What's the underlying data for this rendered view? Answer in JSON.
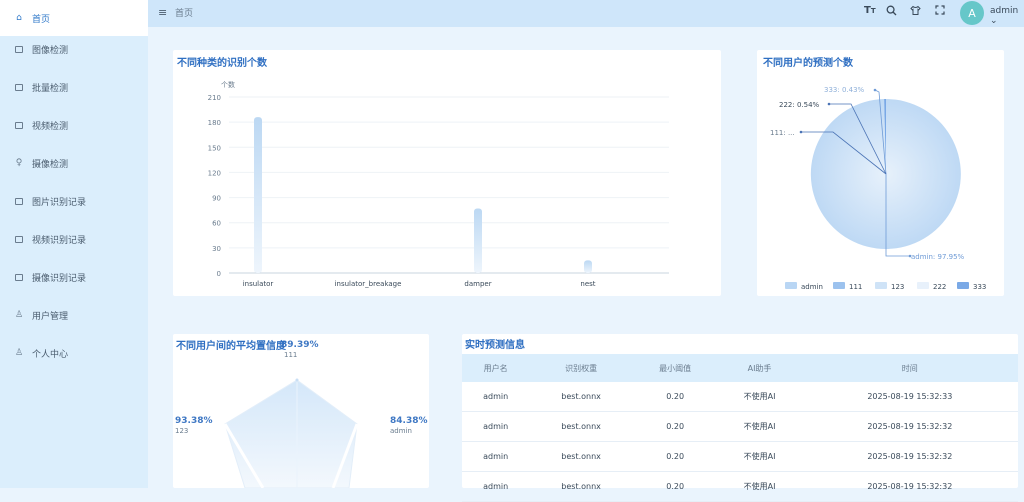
{
  "sidebar": {
    "items": [
      {
        "label": "首页",
        "icon": "home-icon"
      },
      {
        "label": "图像检测",
        "icon": "image-icon"
      },
      {
        "label": "批量检测",
        "icon": "batch-icon"
      },
      {
        "label": "视频检测",
        "icon": "video-icon"
      },
      {
        "label": "摄像检测",
        "icon": "camera-icon"
      },
      {
        "label": "图片识别记录",
        "icon": "image-record-icon"
      },
      {
        "label": "视频识别记录",
        "icon": "video-record-icon"
      },
      {
        "label": "摄像识别记录",
        "icon": "camera-record-icon"
      },
      {
        "label": "用户管理",
        "icon": "user-manage-icon"
      },
      {
        "label": "个人中心",
        "icon": "profile-icon"
      }
    ]
  },
  "header": {
    "menu_icon": "menu-icon",
    "breadcrumb": "首页",
    "font_size_icon_label": "T",
    "user": "admin",
    "avatar_char": "A"
  },
  "bar_chart": {
    "title": "不同种类的识别个数",
    "y_unit": "个数",
    "y_ticks": [
      "0",
      "30",
      "60",
      "90",
      "120",
      "150",
      "180",
      "210"
    ],
    "ylim": [
      0,
      210
    ],
    "categories": [
      "insulator",
      "insulator_breakage",
      "damper",
      "nest"
    ],
    "values": [
      186,
      0,
      77,
      15
    ],
    "color": "#bcd8f3"
  },
  "pie_chart": {
    "title": "不同用户的预测个数",
    "slices": [
      {
        "name": "admin",
        "percent": 97.95,
        "label": "admin: 97.95%",
        "color": "#b9d6f4"
      },
      {
        "name": "111",
        "percent": 0.54,
        "label": "111: ...",
        "color": "#9cc2ee"
      },
      {
        "name": "123",
        "percent": 0.54,
        "label": "",
        "color": "#cfe3f7"
      },
      {
        "name": "222",
        "percent": 0.54,
        "label": "222: 0.54%",
        "color": "#e8f1fb"
      },
      {
        "name": "333",
        "percent": 0.43,
        "label": "333: 0.43%",
        "color": "#7aa9e6"
      }
    ],
    "legend": [
      "admin",
      "111",
      "123",
      "222",
      "333"
    ]
  },
  "radar_chart": {
    "title": "不同用户间的平均置信度",
    "points": [
      {
        "user": "111",
        "value": "89.39%"
      },
      {
        "user": "admin",
        "value": "84.38%"
      },
      {
        "user": "123",
        "value": "93.38%"
      }
    ]
  },
  "table": {
    "title": "实时预测信息",
    "headers": [
      "用户名",
      "识别权重",
      "最小阈值",
      "AI助手",
      "时间"
    ],
    "rows": [
      [
        "admin",
        "best.onnx",
        "0.20",
        "不使用AI",
        "2025-08-19 15:32:33"
      ],
      [
        "admin",
        "best.onnx",
        "0.20",
        "不使用AI",
        "2025-08-19 15:32:32"
      ],
      [
        "admin",
        "best.onnx",
        "0.20",
        "不使用AI",
        "2025-08-19 15:32:32"
      ],
      [
        "admin",
        "best.onnx",
        "0.20",
        "不使用AI",
        "2025-08-19 15:32:32"
      ]
    ]
  }
}
